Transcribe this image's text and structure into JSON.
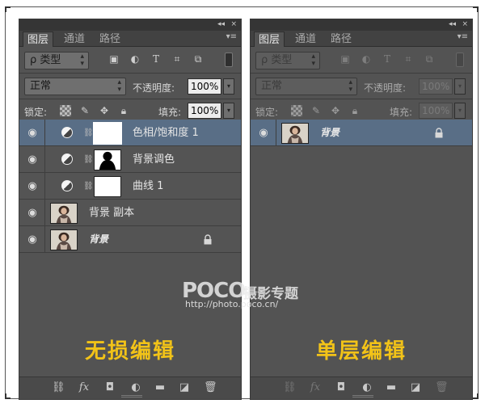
{
  "left_panel": {
    "collapse_icon": "double-chevron-left",
    "close_label": "×",
    "tabs": [
      {
        "label": "图层"
      },
      {
        "label": "通道"
      },
      {
        "label": "路径"
      }
    ],
    "filter": {
      "label": "ρ 类型"
    },
    "blend_mode": "正常",
    "opacity_label": "不透明度:",
    "opacity_value": "100%",
    "lock_label": "锁定:",
    "fill_label": "填充:",
    "fill_value": "100%",
    "layers": [
      {
        "name": "色相/饱和度 1",
        "kind": "adjustment",
        "selected": true
      },
      {
        "name": "背景调色",
        "kind": "adjustment",
        "selected": false
      },
      {
        "name": "曲线 1",
        "kind": "adjustment",
        "selected": false
      },
      {
        "name": "背景 副本",
        "kind": "photo",
        "selected": false
      },
      {
        "name": "背景",
        "kind": "photo-locked",
        "selected": false
      }
    ],
    "caption": "无损编辑"
  },
  "right_panel": {
    "collapse_icon": "double-chevron-left",
    "close_label": "×",
    "tabs": [
      {
        "label": "图层"
      },
      {
        "label": "通道"
      },
      {
        "label": "路径"
      }
    ],
    "filter": {
      "label": "ρ 类型"
    },
    "blend_mode": "正常",
    "opacity_label": "不透明度:",
    "opacity_value": "100%",
    "lock_label": "锁定:",
    "fill_label": "填充:",
    "fill_value": "100%",
    "layers": [
      {
        "name": "背景",
        "kind": "photo-locked",
        "selected": true
      }
    ],
    "caption": "单层编辑"
  },
  "watermark": {
    "logo": "POCO",
    "subtitle": "摄影专题",
    "url": "http://photo.poco.cn/"
  },
  "colors": {
    "panel_bg": "#535353",
    "selected_row": "#596e86",
    "caption": "#f2c318"
  }
}
